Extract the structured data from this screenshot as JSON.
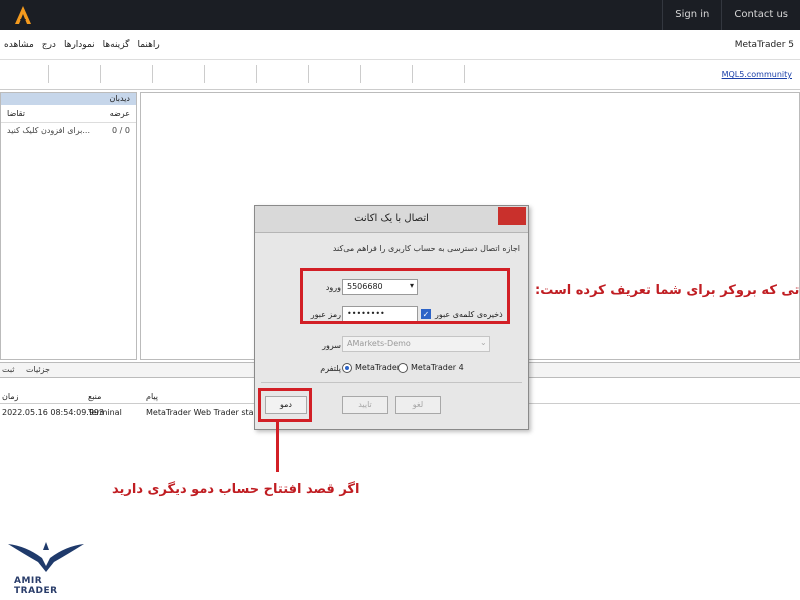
{
  "topbar": {
    "sign_in": "Sign in",
    "contact_us": "Contact us"
  },
  "menu": {
    "items": [
      "راهنما",
      "گزینه‌ها",
      "نمودارها",
      "درج",
      "مشاهده"
    ],
    "app_title": "MetaTrader 5"
  },
  "toolbar": {
    "mql_link": "MQL5.community"
  },
  "market_watch": {
    "header": "دیدبان",
    "col_symbol": "عرضه",
    "col_bid": "تقاضا",
    "row_symbol": "0 / 0",
    "row_text": "برای افزودن کلیک کنید..."
  },
  "tabs": {
    "details": "جزئیات",
    "journal": "ثبت"
  },
  "journal": {
    "col_time": "زمان",
    "col_source": "منبع",
    "col_message": "پیام",
    "row_time": "2022.05.16 08:54:09.993",
    "row_source": "Terminal",
    "row_message": "MetaTrader Web Trader started (rev."
  },
  "dialog": {
    "title": "اتصال با یک اکانت",
    "instruction": "اجازه اتصال دسترسی به حساب کاربری را فراهم می‌کند",
    "login_label": "ورود",
    "login_value": "5506680",
    "password_label": "رمز عبور",
    "password_value": "••••••••",
    "save_password_label": "ذخیره‌ی کلمه‌ی عبور",
    "save_password_checked": true,
    "server_label": "سرور",
    "server_value": "AMarkets-Demo",
    "platform_label": "پلتفرم",
    "platform_options": [
      "MetaTrader 5",
      "MetaTrader 4"
    ],
    "platform_selected": "MetaTrader 5",
    "demo_button": "دمو",
    "ok_button": "تایید",
    "cancel_button": "لغو"
  },
  "annotations": {
    "broker_info": "اطلاعاتی که بروکر برای شما تعریف کرده است:",
    "demo_hint": "اگر قصد افتتاح حساب دمو دیگری دارید",
    "color": "#d21f26"
  },
  "watermark": {
    "brand": "AMIR TRADER"
  },
  "icons": {
    "app_logo": "orange-a-logo-icon",
    "close": "close-icon",
    "dropdown": "chevron-down-icon"
  }
}
